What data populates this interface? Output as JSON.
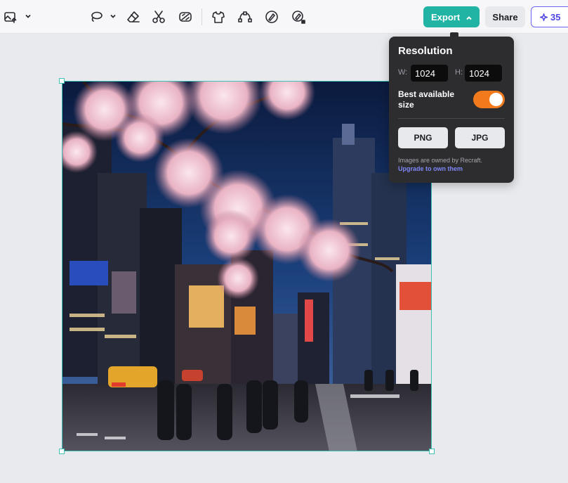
{
  "toolbar": {
    "tools": [
      {
        "icon": "image-upload-icon"
      },
      {
        "icon": "lasso-icon"
      },
      {
        "icon": "eraser-icon"
      },
      {
        "icon": "scissors-icon"
      },
      {
        "icon": "background-remove-icon"
      },
      {
        "icon": "tshirt-mockup-icon"
      },
      {
        "icon": "vectorize-icon"
      },
      {
        "icon": "brush-edit-icon"
      },
      {
        "icon": "magic-lock-icon"
      }
    ],
    "export_label": "Export",
    "share_label": "Share",
    "credits": "35"
  },
  "export_popover": {
    "title": "Resolution",
    "width_label": "W:",
    "width_value": "1024",
    "height_label": "H:",
    "height_value": "1024",
    "best_size_label": "Best available size",
    "best_size_enabled": true,
    "format_buttons": [
      "PNG",
      "JPG"
    ],
    "ownership_note": "Images are owned by Recraft.",
    "upgrade_link": "Upgrade to own them"
  },
  "canvas": {
    "image_description_icon": "city-cherry-blossom-image"
  },
  "colors": {
    "accent": "#21b3a4",
    "toggle_on": "#f07a1c",
    "credits": "#4f46e5",
    "popover_bg": "#2d2d30"
  }
}
